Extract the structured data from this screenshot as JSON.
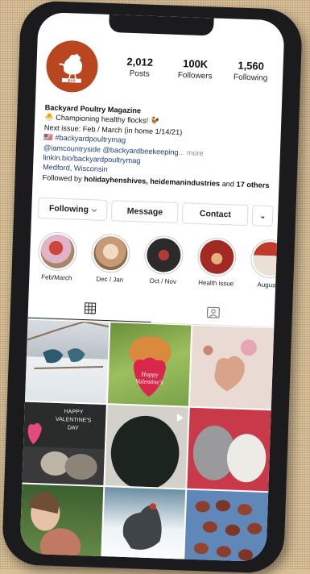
{
  "profile": {
    "avatar_text": "BYP",
    "stats": [
      {
        "value": "2,012",
        "label": "Posts"
      },
      {
        "value": "100K",
        "label": "Followers"
      },
      {
        "value": "1,560",
        "label": "Following"
      }
    ]
  },
  "bio": {
    "name": "Backyard Poultry Magazine",
    "line1": "🐣 Championing healthy flocks! 🐓",
    "line2": "Next issue: Feb / March (in home 1/14/21)",
    "line3": "🇺🇸 #backyardpoultrymag",
    "line4_links": "@iamcountryside @backyardbeekeeping",
    "line4_more": "... more",
    "line5": "linkin.bio/backyardpoultrymag",
    "line6": "Medford, Wisconsin",
    "followed_prefix": "Followed by",
    "followed_names": "holidayhenshives, heidemanindustries",
    "followed_and": "and",
    "followed_others": "17 others"
  },
  "buttons": {
    "following": "Following",
    "message": "Message",
    "contact": "Contact"
  },
  "stories": [
    {
      "label": "Feb/March"
    },
    {
      "label": "Dec / Jan"
    },
    {
      "label": "Oct / Nov"
    },
    {
      "label": "Health issue"
    },
    {
      "label": "August /"
    }
  ],
  "posts": [
    {
      "text": ""
    },
    {
      "text": "Happy Valentine's"
    },
    {
      "text": ""
    },
    {
      "text": "HAPPY VALENTINE'S DAY"
    },
    {
      "text": ""
    },
    {
      "text": ""
    },
    {
      "text": ""
    },
    {
      "text": ""
    },
    {
      "text": ""
    }
  ]
}
